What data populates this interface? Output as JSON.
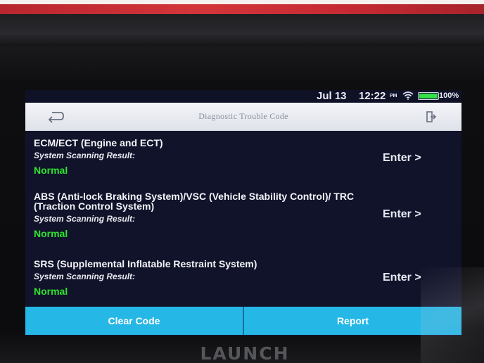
{
  "status_bar": {
    "date": "Jul 13",
    "time": "12:22",
    "ampm": "PM",
    "battery": "100%"
  },
  "header": {
    "title": "Diagnostic Trouble Code"
  },
  "systems": [
    {
      "name": "ECM/ECT (Engine and ECT)",
      "result_label": "System Scanning Result:",
      "result_value": "Normal",
      "action_label": "Enter >"
    },
    {
      "name": "ABS (Anti-lock Braking System)/VSC (Vehicle Stability Control)/ TRC (Traction Control System)",
      "result_label": "System Scanning Result:",
      "result_value": "Normal",
      "action_label": "Enter >"
    },
    {
      "name": "SRS (Supplemental Inflatable Restraint System)",
      "result_label": "System Scanning Result:",
      "result_value": "Normal",
      "action_label": "Enter >"
    }
  ],
  "footer": {
    "clear_code_label": "Clear Code",
    "report_label": "Report"
  },
  "device": {
    "brand": "LAUNCH"
  },
  "colors": {
    "normal_status": "#2ee52f",
    "action_bar": "#25b7e6",
    "screen_background": "#11132a"
  }
}
